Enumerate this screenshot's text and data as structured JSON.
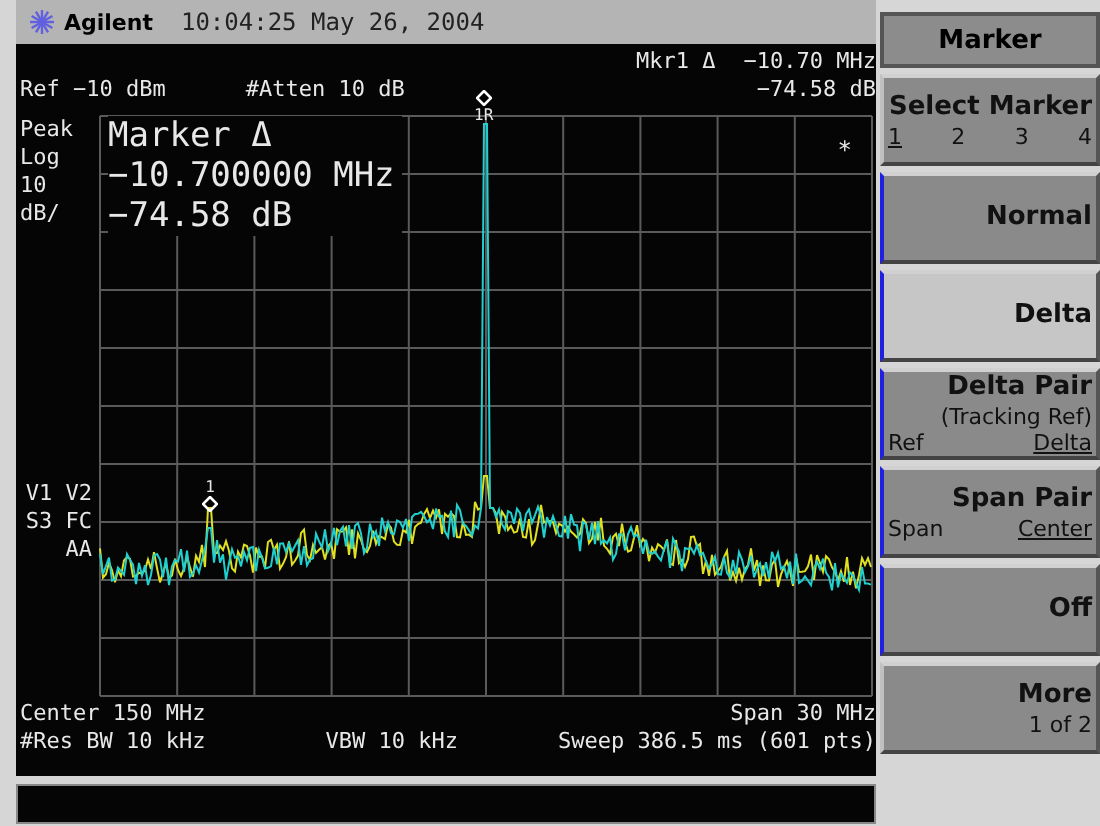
{
  "header": {
    "brand": "Agilent",
    "timestamp": "10:04:25  May 26, 2004"
  },
  "screen": {
    "marker_readout": {
      "label": "Mkr1 Δ",
      "frequency": "−10.70 MHz",
      "amplitude": "−74.58 dB"
    },
    "ref_level": "Ref −10 dBm",
    "attenuation": "#Atten 10 dB",
    "scale_labels": [
      "Peak",
      "Log",
      "10",
      "dB/"
    ],
    "status_labels": [
      "V1 V2",
      "S3 FC",
      "AA"
    ],
    "marker_box": {
      "title": "Marker Δ",
      "frequency": "−10.700000 MHz",
      "amplitude": "−74.58 dB"
    },
    "asterisk": "*",
    "markers": [
      {
        "label": "1R",
        "kind": "reference"
      },
      {
        "label": "1",
        "kind": "delta"
      }
    ],
    "center": "Center 150 MHz",
    "span": "Span 30 MHz",
    "res_bw": "#Res BW 10 kHz",
    "vbw": "VBW 10 kHz",
    "sweep": "Sweep 386.5 ms (601 pts)"
  },
  "softkeys": {
    "title": "Marker",
    "keys": [
      {
        "kind": "options",
        "label": "Select Marker",
        "selected": false,
        "options": [
          {
            "label": "1",
            "selected": true
          },
          {
            "label": "2",
            "selected": false
          },
          {
            "label": "3",
            "selected": false
          },
          {
            "label": "4",
            "selected": false
          }
        ]
      },
      {
        "kind": "plain",
        "label": "Normal",
        "selected": false
      },
      {
        "kind": "plain",
        "label": "Delta",
        "selected": true
      },
      {
        "kind": "pair",
        "label": "Delta Pair",
        "sublabel": "(Tracking Ref)",
        "selected": false,
        "options": [
          {
            "label": "Ref",
            "selected": false
          },
          {
            "label": "Delta",
            "selected": true
          }
        ]
      },
      {
        "kind": "pair",
        "label": "Span Pair",
        "selected": false,
        "options": [
          {
            "label": "Span",
            "selected": false
          },
          {
            "label": "Center",
            "selected": true
          }
        ]
      },
      {
        "kind": "plain",
        "label": "Off",
        "selected": false
      },
      {
        "kind": "more",
        "label": "More",
        "sublabel": "1 of 2",
        "selected": false
      }
    ]
  }
}
